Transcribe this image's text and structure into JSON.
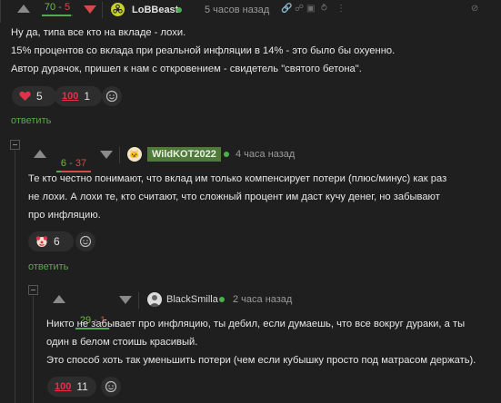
{
  "comments": [
    {
      "score_plus": "70",
      "score_sep": " - ",
      "score_minus": "5",
      "score_ratio": 0.93,
      "username": "LoBBeast",
      "time": "5 часов назад",
      "text_lines": [
        "Ну да, типа все кто на вкладе - лохи.",
        "15% процентов со вклада при реальной инфляции в 14% - это было бы охуенно.",
        "Автор дурачок, пришел к нам с откровением - свидетель \"святого бетона\"."
      ],
      "reactions": [
        {
          "icon": "heart-icon",
          "count": "5"
        },
        {
          "icon": "hundred-icon",
          "count": "1"
        }
      ],
      "reply_label": "ответить"
    },
    {
      "score_plus": "6",
      "score_sep": " - ",
      "score_minus": "37",
      "score_ratio": 0.14,
      "username": "WildKOT2022",
      "username_badge_color": "#4f7a3a",
      "time": "4 часа назад",
      "text_lines": [
        "Те кто честно понимают, что вклад им только компенсирует потери (плюс/минус) как раз",
        "не лохи. А лохи те, кто считают, что сложный процент им даст кучу денег, но забывают",
        "про инфляцию."
      ],
      "reactions": [
        {
          "icon": "clown-icon",
          "count": "6"
        }
      ],
      "reply_label": "ответить"
    },
    {
      "score_plus": "29",
      "score_sep": " - ",
      "score_minus": "1",
      "score_ratio": 0.97,
      "username": "BlackSmilla",
      "time": "2 часа назад",
      "text_lines": [
        "Никто не забывает про инфляцию, ты дебил, если думаешь, что все вокруг дураки, а ты",
        "один в белом стоишь красивый.",
        "Это способ хоть так уменьшить потери (чем если кубышку просто под матрасом держать)."
      ],
      "reactions": [
        {
          "icon": "hundred-icon",
          "count": "11"
        }
      ]
    }
  ],
  "colors": {
    "background": "#1f1f1f",
    "plus": "#6fbf3f",
    "minus": "#d44a4a",
    "reply": "#5aa84a"
  }
}
